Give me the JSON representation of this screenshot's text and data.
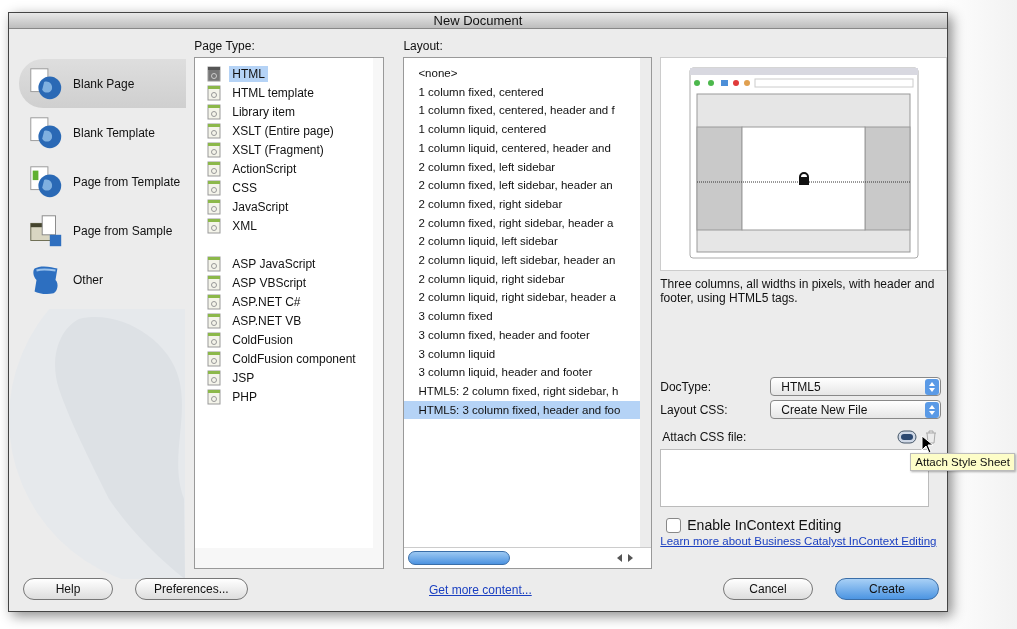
{
  "window": {
    "title": "New Document"
  },
  "categories": [
    {
      "label": "Blank Page",
      "selected": true
    },
    {
      "label": "Blank Template",
      "selected": false
    },
    {
      "label": "Page from Template",
      "selected": false
    },
    {
      "label": "Page from Sample",
      "selected": false
    },
    {
      "label": "Other",
      "selected": false
    }
  ],
  "page_type": {
    "heading": "Page Type:",
    "groups": [
      {
        "items": [
          {
            "label": "HTML",
            "selected": true
          },
          {
            "label": "HTML template",
            "selected": false
          },
          {
            "label": "Library item",
            "selected": false
          },
          {
            "label": "XSLT (Entire page)",
            "selected": false
          },
          {
            "label": "XSLT (Fragment)",
            "selected": false
          },
          {
            "label": "ActionScript",
            "selected": false
          },
          {
            "label": "CSS",
            "selected": false
          },
          {
            "label": "JavaScript",
            "selected": false
          },
          {
            "label": "XML",
            "selected": false
          }
        ]
      },
      {
        "items": [
          {
            "label": "ASP JavaScript",
            "selected": false
          },
          {
            "label": "ASP VBScript",
            "selected": false
          },
          {
            "label": "ASP.NET C#",
            "selected": false
          },
          {
            "label": "ASP.NET VB",
            "selected": false
          },
          {
            "label": "ColdFusion",
            "selected": false
          },
          {
            "label": "ColdFusion component",
            "selected": false
          },
          {
            "label": "JSP",
            "selected": false
          },
          {
            "label": "PHP",
            "selected": false
          }
        ]
      }
    ]
  },
  "layout": {
    "heading": "Layout:",
    "items": [
      {
        "label": "<none>",
        "selected": false
      },
      {
        "label": "1 column fixed, centered",
        "selected": false
      },
      {
        "label": "1 column fixed, centered, header and f",
        "selected": false
      },
      {
        "label": "1 column liquid, centered",
        "selected": false
      },
      {
        "label": "1 column liquid, centered, header and",
        "selected": false
      },
      {
        "label": "2 column fixed, left sidebar",
        "selected": false
      },
      {
        "label": "2 column fixed, left sidebar, header an",
        "selected": false
      },
      {
        "label": "2 column fixed, right sidebar",
        "selected": false
      },
      {
        "label": "2 column fixed, right sidebar, header a",
        "selected": false
      },
      {
        "label": "2 column liquid, left sidebar",
        "selected": false
      },
      {
        "label": "2 column liquid, left sidebar, header an",
        "selected": false
      },
      {
        "label": "2 column liquid, right sidebar",
        "selected": false
      },
      {
        "label": "2 column liquid, right sidebar, header a",
        "selected": false
      },
      {
        "label": "3 column fixed",
        "selected": false
      },
      {
        "label": "3 column fixed, header and footer",
        "selected": false
      },
      {
        "label": "3 column liquid",
        "selected": false
      },
      {
        "label": "3 column liquid, header and footer",
        "selected": false
      },
      {
        "label": "HTML5: 2 column fixed, right sidebar, h",
        "selected": false
      },
      {
        "label": "HTML5: 3 column fixed, header and foo",
        "selected": true
      }
    ]
  },
  "preview": {
    "description": "Three columns, all widths in pixels, with header and footer, using HTML5 tags."
  },
  "doctype": {
    "label": "DocType:",
    "value": "HTML5"
  },
  "layout_css": {
    "label": "Layout CSS:",
    "value": "Create New File"
  },
  "attach_css": {
    "label": "Attach CSS file:",
    "tooltip": "Attach Style Sheet"
  },
  "incontext": {
    "label": "Enable InContext Editing",
    "checked": false
  },
  "learn_more_link": "Learn more about Business Catalyst InContext Editing",
  "get_more_link": "Get more content...",
  "left_buttons": [
    {
      "label": "Help",
      "default": false
    },
    {
      "label": "Preferences...",
      "default": false
    }
  ],
  "right_buttons": [
    {
      "label": "Cancel",
      "default": false
    },
    {
      "label": "Create",
      "default": true
    }
  ]
}
